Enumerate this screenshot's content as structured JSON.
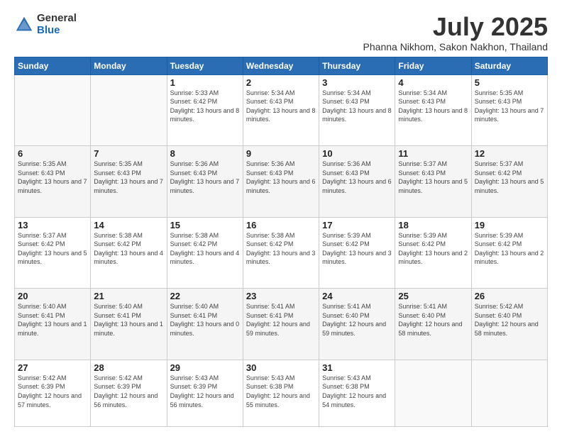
{
  "logo": {
    "general": "General",
    "blue": "Blue"
  },
  "title": "July 2025",
  "subtitle": "Phanna Nikhom, Sakon Nakhon, Thailand",
  "days_header": [
    "Sunday",
    "Monday",
    "Tuesday",
    "Wednesday",
    "Thursday",
    "Friday",
    "Saturday"
  ],
  "weeks": [
    [
      {
        "day": "",
        "sunrise": "",
        "sunset": "",
        "daylight": ""
      },
      {
        "day": "",
        "sunrise": "",
        "sunset": "",
        "daylight": ""
      },
      {
        "day": "1",
        "sunrise": "Sunrise: 5:33 AM",
        "sunset": "Sunset: 6:42 PM",
        "daylight": "Daylight: 13 hours and 8 minutes."
      },
      {
        "day": "2",
        "sunrise": "Sunrise: 5:34 AM",
        "sunset": "Sunset: 6:43 PM",
        "daylight": "Daylight: 13 hours and 8 minutes."
      },
      {
        "day": "3",
        "sunrise": "Sunrise: 5:34 AM",
        "sunset": "Sunset: 6:43 PM",
        "daylight": "Daylight: 13 hours and 8 minutes."
      },
      {
        "day": "4",
        "sunrise": "Sunrise: 5:34 AM",
        "sunset": "Sunset: 6:43 PM",
        "daylight": "Daylight: 13 hours and 8 minutes."
      },
      {
        "day": "5",
        "sunrise": "Sunrise: 5:35 AM",
        "sunset": "Sunset: 6:43 PM",
        "daylight": "Daylight: 13 hours and 7 minutes."
      }
    ],
    [
      {
        "day": "6",
        "sunrise": "Sunrise: 5:35 AM",
        "sunset": "Sunset: 6:43 PM",
        "daylight": "Daylight: 13 hours and 7 minutes."
      },
      {
        "day": "7",
        "sunrise": "Sunrise: 5:35 AM",
        "sunset": "Sunset: 6:43 PM",
        "daylight": "Daylight: 13 hours and 7 minutes."
      },
      {
        "day": "8",
        "sunrise": "Sunrise: 5:36 AM",
        "sunset": "Sunset: 6:43 PM",
        "daylight": "Daylight: 13 hours and 7 minutes."
      },
      {
        "day": "9",
        "sunrise": "Sunrise: 5:36 AM",
        "sunset": "Sunset: 6:43 PM",
        "daylight": "Daylight: 13 hours and 6 minutes."
      },
      {
        "day": "10",
        "sunrise": "Sunrise: 5:36 AM",
        "sunset": "Sunset: 6:43 PM",
        "daylight": "Daylight: 13 hours and 6 minutes."
      },
      {
        "day": "11",
        "sunrise": "Sunrise: 5:37 AM",
        "sunset": "Sunset: 6:43 PM",
        "daylight": "Daylight: 13 hours and 5 minutes."
      },
      {
        "day": "12",
        "sunrise": "Sunrise: 5:37 AM",
        "sunset": "Sunset: 6:42 PM",
        "daylight": "Daylight: 13 hours and 5 minutes."
      }
    ],
    [
      {
        "day": "13",
        "sunrise": "Sunrise: 5:37 AM",
        "sunset": "Sunset: 6:42 PM",
        "daylight": "Daylight: 13 hours and 5 minutes."
      },
      {
        "day": "14",
        "sunrise": "Sunrise: 5:38 AM",
        "sunset": "Sunset: 6:42 PM",
        "daylight": "Daylight: 13 hours and 4 minutes."
      },
      {
        "day": "15",
        "sunrise": "Sunrise: 5:38 AM",
        "sunset": "Sunset: 6:42 PM",
        "daylight": "Daylight: 13 hours and 4 minutes."
      },
      {
        "day": "16",
        "sunrise": "Sunrise: 5:38 AM",
        "sunset": "Sunset: 6:42 PM",
        "daylight": "Daylight: 13 hours and 3 minutes."
      },
      {
        "day": "17",
        "sunrise": "Sunrise: 5:39 AM",
        "sunset": "Sunset: 6:42 PM",
        "daylight": "Daylight: 13 hours and 3 minutes."
      },
      {
        "day": "18",
        "sunrise": "Sunrise: 5:39 AM",
        "sunset": "Sunset: 6:42 PM",
        "daylight": "Daylight: 13 hours and 2 minutes."
      },
      {
        "day": "19",
        "sunrise": "Sunrise: 5:39 AM",
        "sunset": "Sunset: 6:42 PM",
        "daylight": "Daylight: 13 hours and 2 minutes."
      }
    ],
    [
      {
        "day": "20",
        "sunrise": "Sunrise: 5:40 AM",
        "sunset": "Sunset: 6:41 PM",
        "daylight": "Daylight: 13 hours and 1 minute."
      },
      {
        "day": "21",
        "sunrise": "Sunrise: 5:40 AM",
        "sunset": "Sunset: 6:41 PM",
        "daylight": "Daylight: 13 hours and 1 minute."
      },
      {
        "day": "22",
        "sunrise": "Sunrise: 5:40 AM",
        "sunset": "Sunset: 6:41 PM",
        "daylight": "Daylight: 13 hours and 0 minutes."
      },
      {
        "day": "23",
        "sunrise": "Sunrise: 5:41 AM",
        "sunset": "Sunset: 6:41 PM",
        "daylight": "Daylight: 12 hours and 59 minutes."
      },
      {
        "day": "24",
        "sunrise": "Sunrise: 5:41 AM",
        "sunset": "Sunset: 6:40 PM",
        "daylight": "Daylight: 12 hours and 59 minutes."
      },
      {
        "day": "25",
        "sunrise": "Sunrise: 5:41 AM",
        "sunset": "Sunset: 6:40 PM",
        "daylight": "Daylight: 12 hours and 58 minutes."
      },
      {
        "day": "26",
        "sunrise": "Sunrise: 5:42 AM",
        "sunset": "Sunset: 6:40 PM",
        "daylight": "Daylight: 12 hours and 58 minutes."
      }
    ],
    [
      {
        "day": "27",
        "sunrise": "Sunrise: 5:42 AM",
        "sunset": "Sunset: 6:39 PM",
        "daylight": "Daylight: 12 hours and 57 minutes."
      },
      {
        "day": "28",
        "sunrise": "Sunrise: 5:42 AM",
        "sunset": "Sunset: 6:39 PM",
        "daylight": "Daylight: 12 hours and 56 minutes."
      },
      {
        "day": "29",
        "sunrise": "Sunrise: 5:43 AM",
        "sunset": "Sunset: 6:39 PM",
        "daylight": "Daylight: 12 hours and 56 minutes."
      },
      {
        "day": "30",
        "sunrise": "Sunrise: 5:43 AM",
        "sunset": "Sunset: 6:38 PM",
        "daylight": "Daylight: 12 hours and 55 minutes."
      },
      {
        "day": "31",
        "sunrise": "Sunrise: 5:43 AM",
        "sunset": "Sunset: 6:38 PM",
        "daylight": "Daylight: 12 hours and 54 minutes."
      },
      {
        "day": "",
        "sunrise": "",
        "sunset": "",
        "daylight": ""
      },
      {
        "day": "",
        "sunrise": "",
        "sunset": "",
        "daylight": ""
      }
    ]
  ]
}
